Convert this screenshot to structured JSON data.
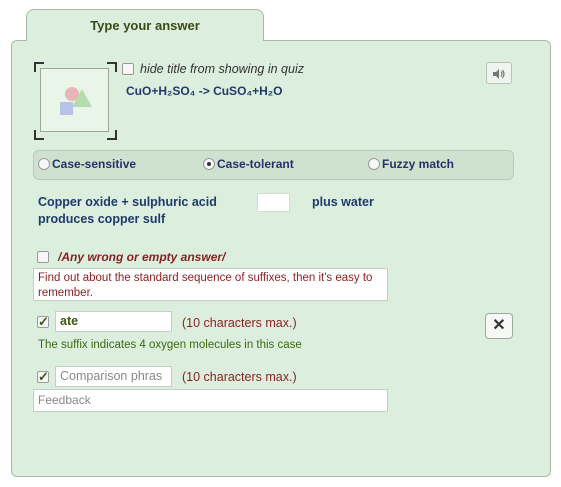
{
  "tab": {
    "label": "Type your answer"
  },
  "question": {
    "hide_title_label": "hide title from showing in quiz",
    "hide_title_checked": false,
    "formula": "CuO+H₂SO₄ -> CuSO₄+H₂O"
  },
  "sound_icon": "speaker-icon",
  "match_modes": {
    "options": [
      {
        "label": "Case-sensitive",
        "selected": false
      },
      {
        "label": "Case-tolerant",
        "selected": true
      },
      {
        "label": "Fuzzy match",
        "selected": false
      }
    ]
  },
  "sentence": {
    "part1_line1": "Copper oxide + sulphuric acid",
    "part1_line2": "produces copper sulf",
    "part2": "plus water"
  },
  "wrong_answer": {
    "checked": false,
    "label": "/Any wrong or empty answer/",
    "feedback": "Find out about the standard sequence of suffixes, then it's easy to remember."
  },
  "answers": [
    {
      "checked": true,
      "value": "ate",
      "max_note": "(10 characters max.)",
      "feedback": "The suffix indicates 4 oxygen molecules in this case"
    },
    {
      "checked": true,
      "placeholder": "Comparison phras",
      "max_note": "(10 characters max.)",
      "feedback_placeholder": "Feedback"
    }
  ],
  "delete_icon": "close-icon",
  "delete_glyph": "✕"
}
